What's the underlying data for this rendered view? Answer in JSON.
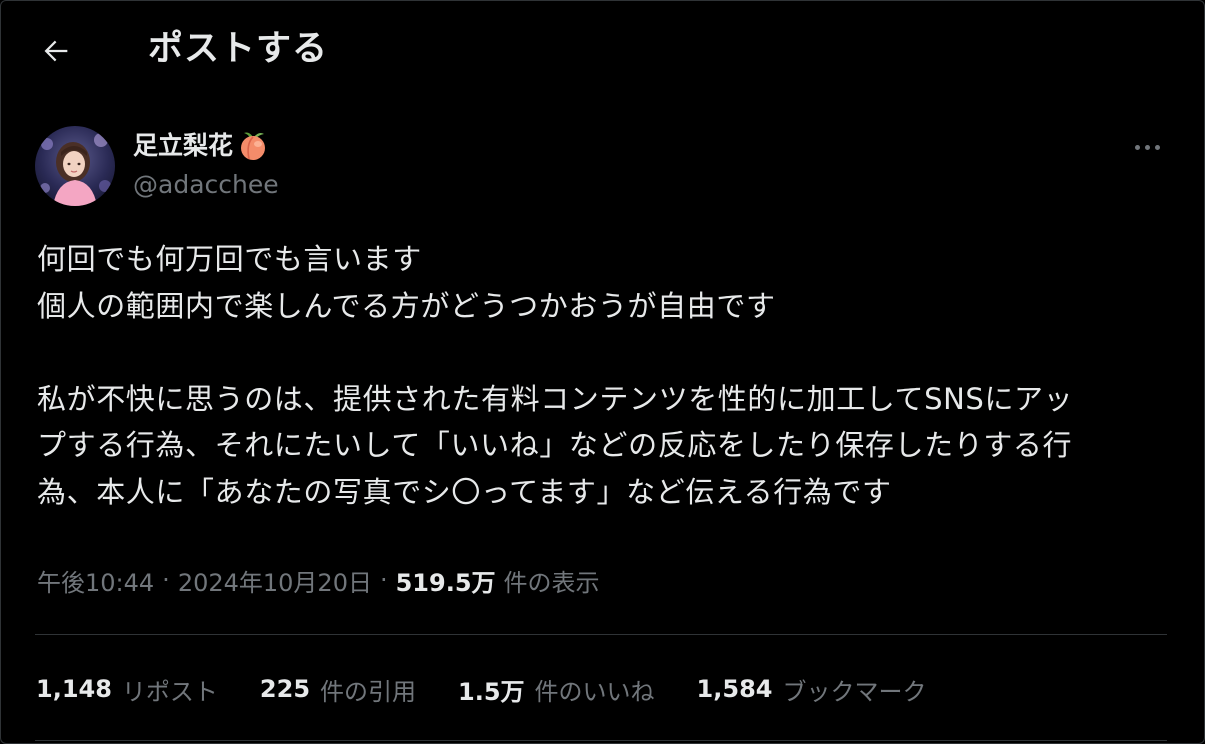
{
  "header": {
    "title": "ポストする",
    "back_icon": "arrow-left-icon"
  },
  "author": {
    "display_name": "足立梨花",
    "name_emoji": "peach-icon",
    "handle": "@adacchee",
    "more_icon": "more-horizontal-icon"
  },
  "tweet": {
    "paragraph1": [
      "何回でも何万回でも言います",
      "個人の範囲内で楽しんでる方がどうつかおうが自由です"
    ],
    "paragraph2": [
      "私が不快に思うのは、提供された有料コンテンツを性的に加工してSNSにアッ",
      "プする行為、それにたいして「いいね」などの反応をしたり保存したりする行",
      "為、本人に「あなたの写真でシ〇ってます」など伝える行為です"
    ]
  },
  "meta": {
    "time": "午後10:44",
    "separator": "·",
    "date": "2024年10月20日",
    "views_count": "519.5万",
    "views_label": "件の表示"
  },
  "stats": {
    "reposts": {
      "count": "1,148",
      "label": "リポスト"
    },
    "quotes": {
      "count": "225",
      "label": "件の引用"
    },
    "likes": {
      "count": "1.5万",
      "label": "件のいいね"
    },
    "bookmarks": {
      "count": "1,584",
      "label": "ブックマーク"
    }
  },
  "colors": {
    "background": "#000000",
    "text_primary": "#e7e9ea",
    "text_secondary": "#71767b",
    "divider": "#2f3336"
  }
}
